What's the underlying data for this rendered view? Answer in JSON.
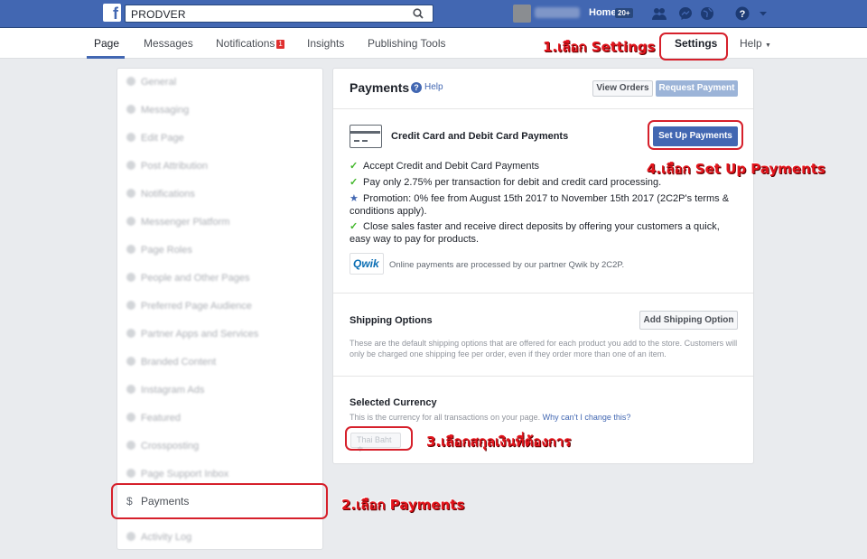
{
  "topbar": {
    "search_value": "PRODVER",
    "home_label": "Home",
    "home_badge": "20+",
    "icons": [
      "facebook-logo",
      "search-icon",
      "friends-icon",
      "messenger-icon",
      "globe-icon",
      "help-icon",
      "dropdown-icon"
    ]
  },
  "subnav": {
    "tabs": [
      {
        "label": "Page"
      },
      {
        "label": "Messages"
      },
      {
        "label": "Notifications"
      },
      {
        "label": "Insights"
      },
      {
        "label": "Publishing Tools"
      }
    ],
    "notifications_badge": "1",
    "settings_label": "Settings",
    "help_label": "Help"
  },
  "sidebar": {
    "items": [
      {
        "label": "General"
      },
      {
        "label": "Messaging"
      },
      {
        "label": "Edit Page"
      },
      {
        "label": "Post Attribution"
      },
      {
        "label": "Notifications"
      },
      {
        "label": "Messenger Platform"
      },
      {
        "label": "Page Roles"
      },
      {
        "label": "People and Other Pages"
      },
      {
        "label": "Preferred Page Audience"
      },
      {
        "label": "Partner Apps and Services"
      },
      {
        "label": "Branded Content"
      },
      {
        "label": "Instagram Ads"
      },
      {
        "label": "Featured"
      },
      {
        "label": "Crossposting"
      },
      {
        "label": "Page Support Inbox"
      },
      {
        "label": "Payments"
      },
      {
        "label": "Activity Log"
      }
    ],
    "payments_icon": "$"
  },
  "payments": {
    "title": "Payments",
    "help": "Help",
    "view_orders": "View Orders",
    "request_payment": "Request Payment",
    "card_title": "Credit Card and Debit Card Payments",
    "setup_button": "Set Up Payments",
    "bullets": [
      "Accept Credit and Debit Card Payments",
      "Pay only 2.75% per transaction for debit and credit card processing.",
      "Promotion: 0% fee from August 15th 2017 to November 15th 2017 (2C2P's terms & conditions apply).",
      "Close sales faster and receive direct deposits by offering your customers a quick, easy way to pay for products."
    ],
    "qwik_logo": "Qwik",
    "qwik_note": "Online payments are processed by our partner Qwik by 2C2P.",
    "shipping_title": "Shipping Options",
    "add_shipping": "Add Shipping Option",
    "shipping_desc": "These are the default shipping options that are offered for each product you add to the store. Customers will only be charged one shipping fee per order, even if they order more than one of an item.",
    "currency_title": "Selected Currency",
    "currency_desc": "This is the currency for all transactions on your page.",
    "currency_link": "Why can't I change this?",
    "currency_value": "Thai Baht ≑"
  },
  "annotations": {
    "step1": "1.เลือก Settings",
    "step2": "2.เลือก Payments",
    "step3": "3.เลือกสกุลเงินที่ต้องการ",
    "step4": "4.เลือก Set Up Payments",
    "color": "#e3141c"
  }
}
